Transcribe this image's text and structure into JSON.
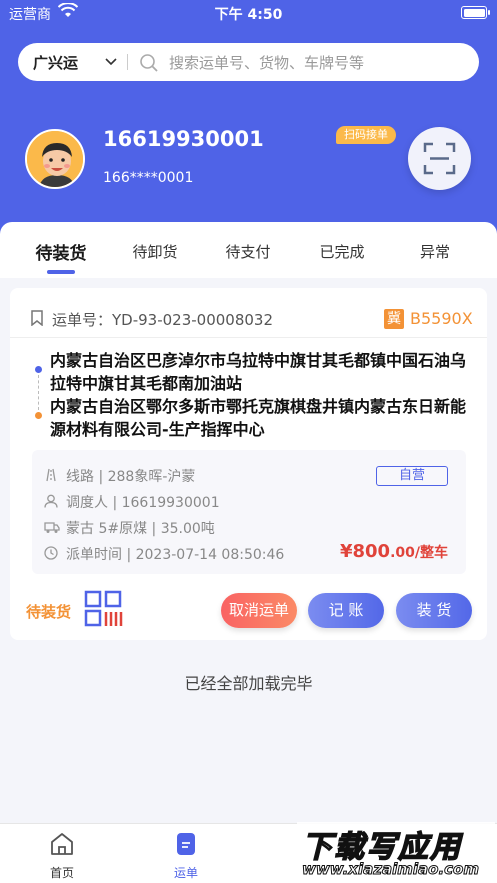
{
  "status_bar": {
    "carrier": "运营商",
    "time": "下午 4:50"
  },
  "search": {
    "city": "广兴运",
    "placeholder": "搜索运单号、货物、车牌号等"
  },
  "profile": {
    "phone": "16619930001",
    "phone_masked": "166****0001",
    "scan_tag": "扫码接单"
  },
  "tabs": [
    {
      "label": "待装货",
      "active": true
    },
    {
      "label": "待卸货",
      "active": false
    },
    {
      "label": "待支付",
      "active": false
    },
    {
      "label": "已完成",
      "active": false
    },
    {
      "label": "异常",
      "active": false
    }
  ],
  "order": {
    "order_no": "运单号：YD-93-023-00008032",
    "plate_province": "冀",
    "plate_number": "B5590X",
    "origin": "内蒙古自治区巴彦淖尔市乌拉特中旗甘其毛都镇中国石油乌拉特中旗甘其毛都南加油站",
    "destination": "内蒙古自治区鄂尔多斯市鄂托克旗棋盘井镇内蒙古东日新能源材料有限公司-生产指挥中心",
    "route": "线路 | 288象晖-沪蒙",
    "dispatcher": "调度人 | 16619930001",
    "cargo": "蒙古 5#原煤 | 35.00吨",
    "dispatch_time": "派单时间 | 2023-07-14 08:50:46",
    "self_operated": "自营",
    "price_main": "¥800",
    "price_unit": ".00/整车",
    "status": "待装货",
    "buttons": {
      "cancel": "取消运单",
      "account": "记 账",
      "load": "装 货"
    }
  },
  "end_text": "已经全部加载完毕",
  "bottom_nav": [
    {
      "label": "首页",
      "icon": "home-icon",
      "active": false
    },
    {
      "label": "运单",
      "icon": "waybill-icon",
      "active": true
    }
  ],
  "watermark": {
    "title": "下载写应用",
    "url": "www.xiazaimiao.com"
  },
  "colors": {
    "primary": "#4f63e7",
    "accent": "#f39236",
    "price": "#e0433a"
  }
}
